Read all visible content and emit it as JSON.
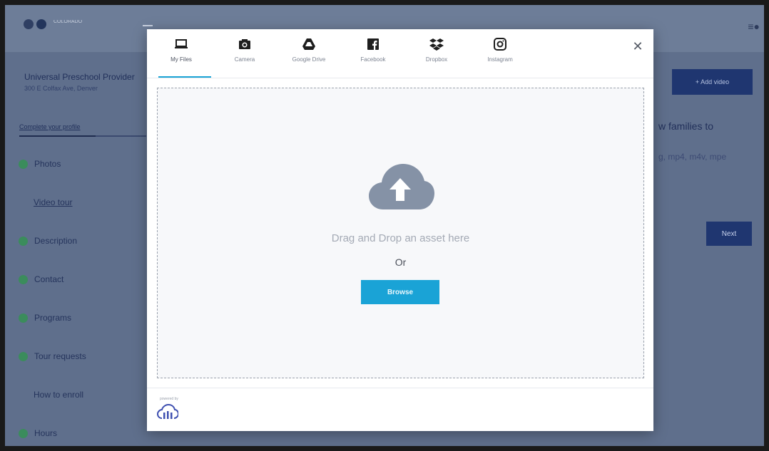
{
  "app": {
    "logo_text": "COLORADO"
  },
  "sidebar": {
    "school_name": "Universal Preschool Provider",
    "school_address": "300 E Colfax Ave, Denver",
    "complete_profile_link": "Complete your profile",
    "profile_progress": 0.6,
    "items": [
      {
        "label": "Photos",
        "completed": true
      },
      {
        "label": "Video tour",
        "completed": false
      },
      {
        "label": "Description",
        "completed": true
      },
      {
        "label": "Contact",
        "completed": true
      },
      {
        "label": "Programs",
        "completed": true
      },
      {
        "label": "Tour requests",
        "completed": true
      },
      {
        "label": "How to enroll",
        "completed": false
      },
      {
        "label": "Hours",
        "completed": true
      }
    ]
  },
  "content": {
    "add_button_label": "+ Add video",
    "heading": "w families to",
    "subtext": "g, mp4, m4v, mpe",
    "next_button_label": "Next"
  },
  "upload_modal": {
    "tabs": [
      {
        "label": "My Files",
        "icon": "laptop-icon",
        "active": true
      },
      {
        "label": "Camera",
        "icon": "camera-icon",
        "active": false
      },
      {
        "label": "Google Drive",
        "icon": "google-drive-icon",
        "active": false
      },
      {
        "label": "Facebook",
        "icon": "facebook-icon",
        "active": false
      },
      {
        "label": "Dropbox",
        "icon": "dropbox-icon",
        "active": false
      },
      {
        "label": "Instagram",
        "icon": "instagram-icon",
        "active": false
      }
    ],
    "close_icon": "close-icon",
    "drop_text": "Drag and Drop an asset here",
    "or_text": "Or",
    "browse_label": "Browse",
    "upload_icon": "cloud-upload-icon",
    "powered_by": "powered by",
    "footer_logo_icon": "cloudinary-logo-icon",
    "accent_color": "#1aa3d6"
  }
}
